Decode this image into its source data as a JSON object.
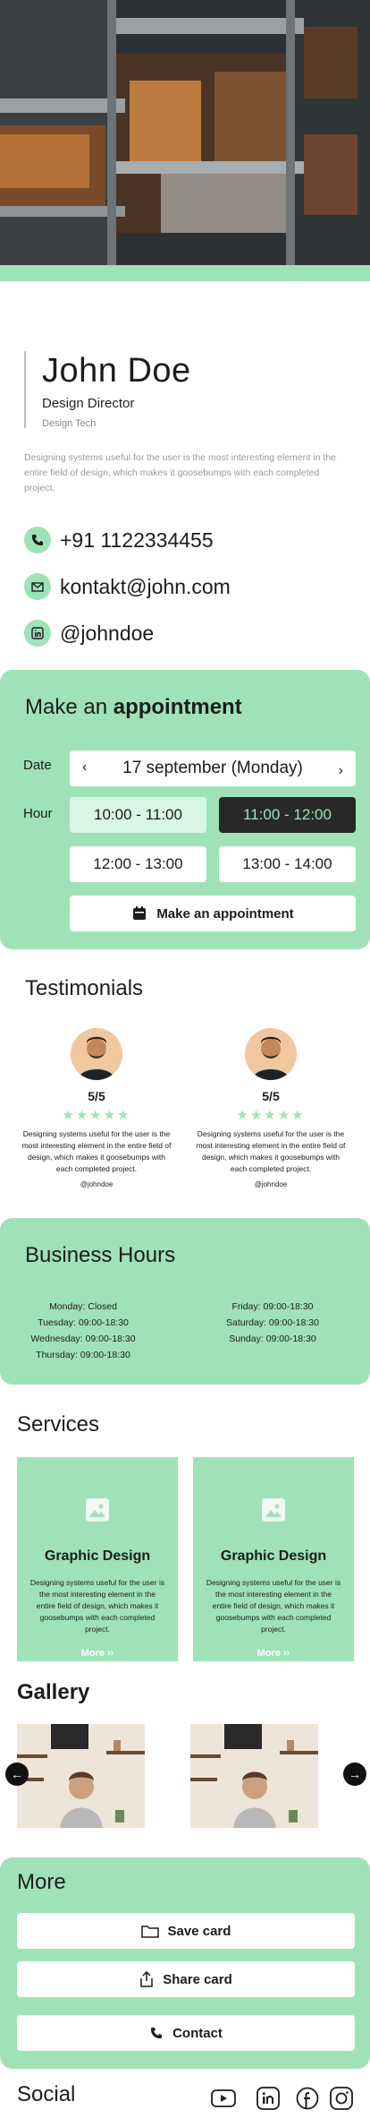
{
  "profile": {
    "name": "John Doe",
    "role": "Design Director",
    "company": "Design Tech",
    "bio": "Designing systems useful for the user is the most interesting element in the entire field of design, which makes it goosebumps with each completed project."
  },
  "contacts": {
    "phone": "+91 1122334455",
    "email": "kontakt@john.com",
    "linkedin": "@johndoe"
  },
  "appointment": {
    "title_prefix": "Make an ",
    "title_bold": "appointment",
    "date_label": "Date",
    "hour_label": "Hour",
    "date_value": "17 september",
    "date_day": "(Monday)",
    "prev_arrow": "‹",
    "next_arrow": "›",
    "slots": [
      "10:00 - 11:00",
      "11:00 - 12:00",
      "12:00 - 13:00",
      "13:00 - 14:00"
    ],
    "button": "Make an appointment"
  },
  "testimonials": {
    "title": "Testimonials",
    "items": [
      {
        "score": "5/5",
        "stars": "★★★★★",
        "text": "Designing systems useful for the user is the most interesting element in the entire field of design, which makes it goosebumps with each completed project.",
        "handle": "@johndoe"
      },
      {
        "score": "5/5",
        "stars": "★★★★★",
        "text": "Designing systems useful for the user is the most interesting element in the entire field of design, which makes it goosebumps with each completed project.",
        "handle": "@johndoe"
      }
    ]
  },
  "hours": {
    "title": "Business Hours",
    "left": [
      "Monday: Closed",
      "Tuesday: 09:00-18:30",
      "Wednesday: 09:00-18:30",
      "Thursday: 09:00-18:30"
    ],
    "right": [
      "Friday: 09:00-18:30",
      "Saturday: 09:00-18:30",
      "Sunday: 09:00-18:30"
    ]
  },
  "services": {
    "title": "Services",
    "items": [
      {
        "title": "Graphic Design",
        "text": "Designing systems useful for the user is the most interesting element in the entire field of design, which makes it goosebumps with each completed project.",
        "more": "More ››"
      },
      {
        "title": "Graphic Design",
        "text": "Designing systems useful for the user is the most interesting element in the entire field of design, which makes it goosebumps with each completed project.",
        "more": "More ››"
      }
    ]
  },
  "gallery": {
    "title": "Gallery",
    "prev": "←",
    "next": "→"
  },
  "more": {
    "title": "More",
    "save": "Save card",
    "share": "Share card",
    "contact": "Contact"
  },
  "social": {
    "title": "Social",
    "icons": [
      "youtube-icon",
      "linkedin-icon",
      "facebook-icon",
      "instagram-icon"
    ]
  },
  "colors": {
    "accent": "#9fe2b7",
    "dark": "#282828"
  }
}
